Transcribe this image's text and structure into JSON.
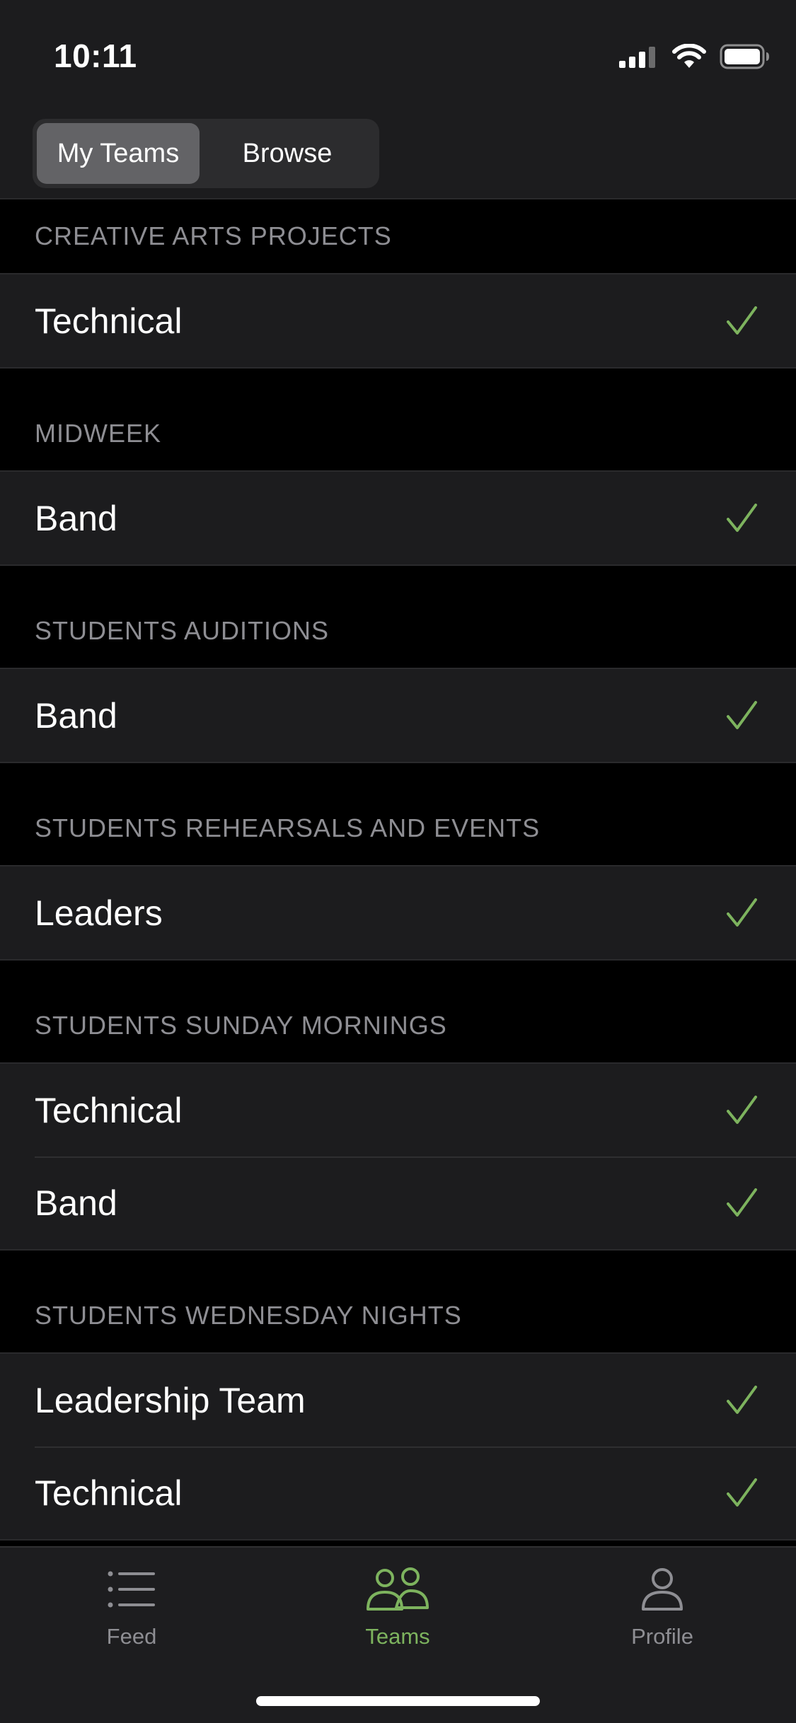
{
  "status_bar": {
    "time": "10:11"
  },
  "segmented_control": {
    "options": [
      "My Teams",
      "Browse"
    ],
    "selected": "My Teams"
  },
  "colors": {
    "accent": "#7db35e",
    "background": "#000000",
    "row_background": "#1c1c1e",
    "section_header_text": "#8e8e93"
  },
  "sections": [
    {
      "title": "CREATIVE ARTS PROJECTS",
      "teams": [
        {
          "name": "Technical",
          "checked": true
        }
      ]
    },
    {
      "title": "MIDWEEK",
      "teams": [
        {
          "name": "Band",
          "checked": true
        }
      ]
    },
    {
      "title": "STUDENTS AUDITIONS",
      "teams": [
        {
          "name": "Band",
          "checked": true
        }
      ]
    },
    {
      "title": "STUDENTS REHEARSALS AND EVENTS",
      "teams": [
        {
          "name": "Leaders",
          "checked": true
        }
      ]
    },
    {
      "title": "STUDENTS SUNDAY MORNINGS",
      "teams": [
        {
          "name": "Technical",
          "checked": true
        },
        {
          "name": "Band",
          "checked": true
        }
      ]
    },
    {
      "title": "STUDENTS WEDNESDAY NIGHTS",
      "teams": [
        {
          "name": "Leadership Team",
          "checked": true
        },
        {
          "name": "Technical",
          "checked": true
        }
      ]
    }
  ],
  "tab_bar": {
    "tabs": [
      {
        "label": "Feed",
        "icon": "list-icon",
        "active": false
      },
      {
        "label": "Teams",
        "icon": "people-icon",
        "active": true
      },
      {
        "label": "Profile",
        "icon": "person-icon",
        "active": false
      }
    ]
  }
}
